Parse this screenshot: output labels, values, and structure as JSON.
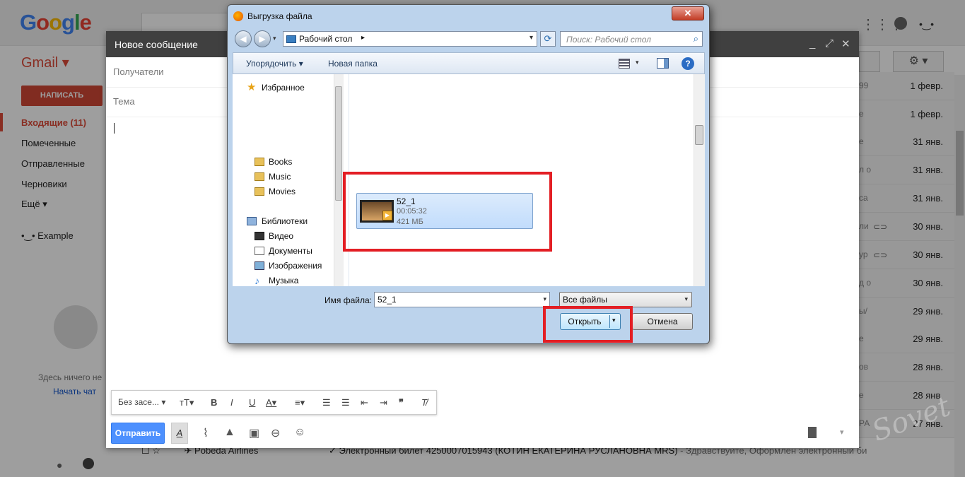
{
  "gmail": {
    "logo_letters": [
      "G",
      "o",
      "o",
      "g",
      "l",
      "e"
    ],
    "product_label": "Gmail ▾",
    "compose_label": "НАПИСАТЬ",
    "nav": {
      "inbox": "Входящие (11)",
      "starred": "Помеченные",
      "sent": "Отправленные",
      "drafts": "Черновики",
      "more": "Ещё ▾"
    },
    "hangouts_user": "Example",
    "hangouts_empty": "Здесь ничего не",
    "start_chat": "Начать чат",
    "mail_rows": [
      {
        "snippet": "99",
        "date": "1 февр."
      },
      {
        "snippet": "е",
        "date": "1 февр."
      },
      {
        "snippet": "е",
        "date": "31 янв."
      },
      {
        "snippet": "л о",
        "date": "31 янв."
      },
      {
        "snippet": "са",
        "date": "31 янв."
      },
      {
        "snippet": "ли",
        "date": "30 янв."
      },
      {
        "snippet": "ур",
        "date": "30 янв."
      },
      {
        "snippet": "д о",
        "date": "30 янв."
      },
      {
        "snippet": "ы/",
        "date": "29 янв."
      },
      {
        "snippet": "е",
        "date": "29 янв."
      },
      {
        "snippet": "ов",
        "date": "28 янв."
      },
      {
        "snippet": "е",
        "date": "28 янв."
      },
      {
        "snippet": "РА",
        "date": "27 янв."
      }
    ],
    "bottom_mail": {
      "sender": "✈ Pobeda Airlines",
      "subject": "✓ Электронный билет 4250007015943 (КОТИН ЕКАТЕРИНА РУСЛАНОВНА MRS)",
      "preview": " - Здравствуйте, Оформлен электронный би",
      "date": "27 янв."
    },
    "watermark": "Sovet"
  },
  "compose": {
    "title": "Новое сообщение",
    "recipients_placeholder": "Получатели",
    "subject_placeholder": "Тема",
    "font_label": "Без засе...",
    "send_label": "Отправить"
  },
  "dialog": {
    "title": "Выгрузка файла",
    "close": "✕",
    "path": "Рабочий стол",
    "search_placeholder": "Поиск: Рабочий стол",
    "organize": "Упорядочить ▾",
    "new_folder": "Новая папка",
    "help": "?",
    "nav_items": {
      "favorites": "Избранное",
      "books": "Books",
      "music": "Music",
      "movies": "Movies",
      "libraries": "Библиотеки",
      "video": "Видео",
      "documents": "Документы",
      "images": "Изображения",
      "music_lib": "Музыка"
    },
    "file": {
      "name": "52_1",
      "duration": "00:05:32",
      "size": "421 МБ"
    },
    "filename_label": "Имя файла:",
    "filename_value": "52_1",
    "filetype_value": "Все файлы",
    "open_label": "Открыть",
    "cancel_label": "Отмена",
    "highlight_color": "#e31e24"
  }
}
